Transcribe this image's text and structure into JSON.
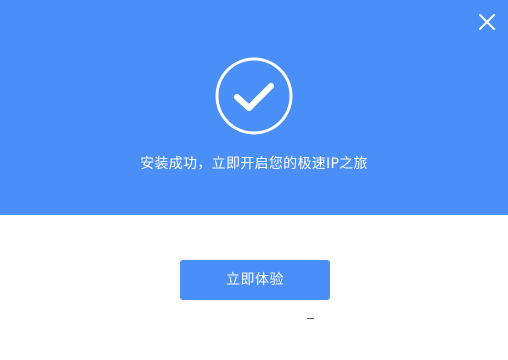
{
  "header": {
    "background_color": "#4a8ff7",
    "close_icon": "close-icon",
    "status_icon": "check-circle-icon",
    "message": "安装成功，立即开启您的极速IP之旅"
  },
  "actions": {
    "primary_label": "立即体验",
    "primary_color": "#4a8ff7"
  }
}
